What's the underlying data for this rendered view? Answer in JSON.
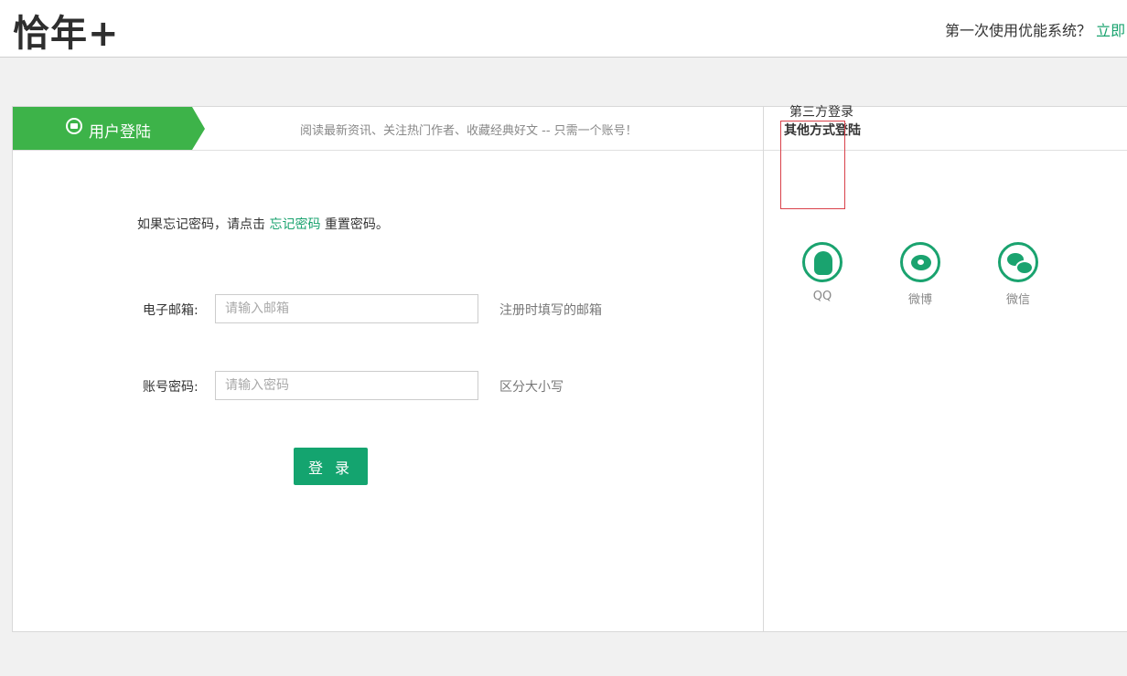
{
  "brand": {
    "logo": "恰年+"
  },
  "topright": {
    "question": "第一次使用优能系统？",
    "link": "立即"
  },
  "login_tab": {
    "label": "用户登陆",
    "icon": "envelope-icon"
  },
  "slogan": "阅读最新资讯、关注热门作者、收藏经典好文 -- 只需一个账号！",
  "other_login": {
    "title": "其他方式登陆",
    "third_party_label": "第三方登录"
  },
  "forgot": {
    "prefix": "如果忘记密码，请点击",
    "link": "忘记密码",
    "suffix": "重置密码。"
  },
  "form": {
    "email": {
      "label": "电子邮箱:",
      "placeholder": "请输入邮箱",
      "hint": "注册时填写的邮箱"
    },
    "password": {
      "label": "账号密码:",
      "placeholder": "请输入密码",
      "hint": "区分大小写"
    },
    "submit": "登 录"
  },
  "social": [
    {
      "name": "QQ",
      "icon": "qq-icon"
    },
    {
      "name": "微博",
      "icon": "weibo-icon"
    },
    {
      "name": "微信",
      "icon": "wechat-icon"
    }
  ],
  "colors": {
    "accent": "#1aa36f",
    "tab_green": "#3db349",
    "highlight": "#d9414a"
  }
}
